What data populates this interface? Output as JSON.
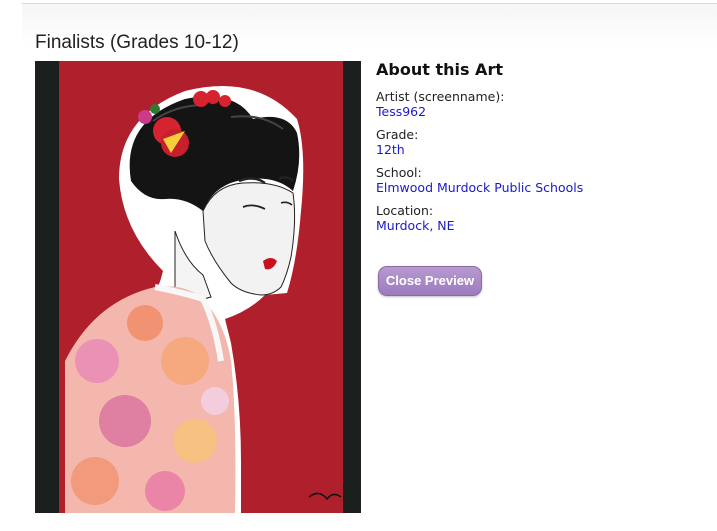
{
  "page": {
    "section_title": "Finalists (Grades 10-12)"
  },
  "about": {
    "heading": "About this Art",
    "fields": [
      {
        "label": "Artist (screenname):",
        "value": "Tess962"
      },
      {
        "label": "Grade:",
        "value": "12th"
      },
      {
        "label": "School:",
        "value": "Elmwood Murdock Public Schools"
      },
      {
        "label": "Location:",
        "value": "Murdock, NE"
      }
    ]
  },
  "actions": {
    "close_label": "Close Preview"
  },
  "colors": {
    "link": "#1a1acc",
    "button": "#a98bc7",
    "artwork_background": "#b0202c"
  }
}
